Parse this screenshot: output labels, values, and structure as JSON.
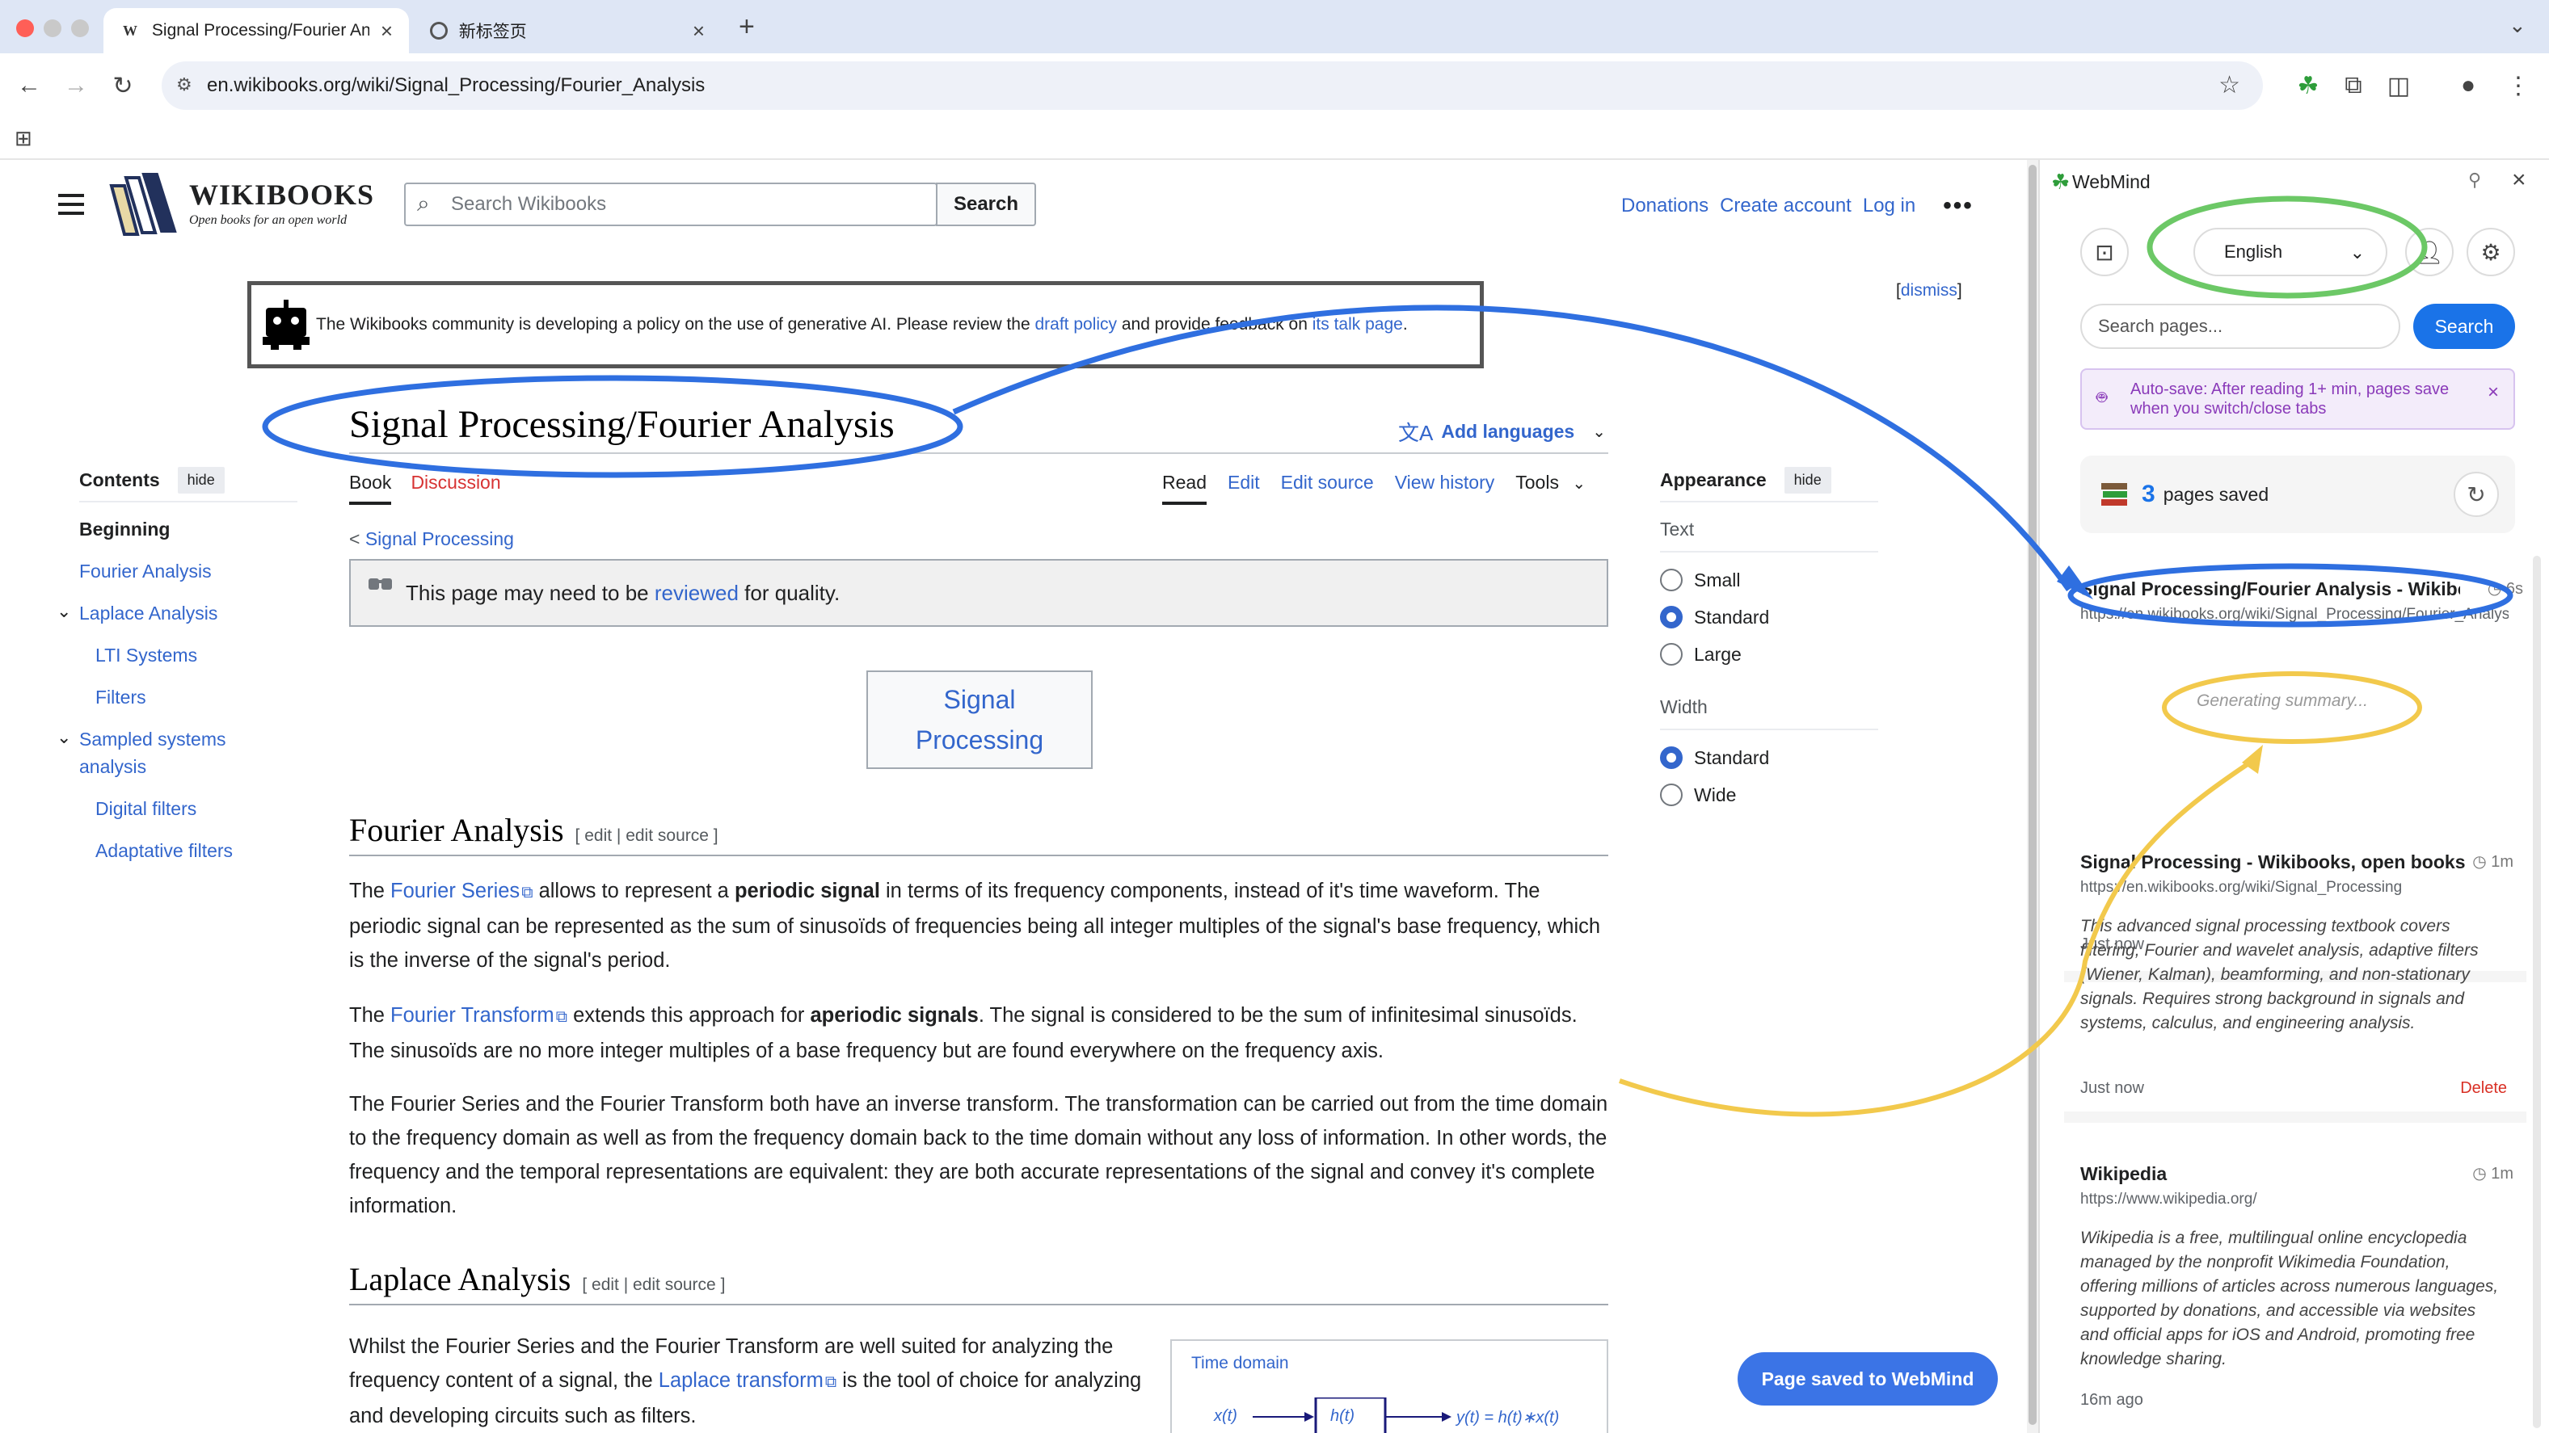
{
  "browser": {
    "tabs": [
      {
        "title": "Signal Processing/Fourier Analysis - Wikibooks, open books for an open world"
      },
      {
        "title": "新标签页"
      }
    ],
    "url": "en.wikibooks.org/wiki/Signal_Processing/Fourier_Analysis"
  },
  "wiki": {
    "logo_word": "WIKIBOOKS",
    "logo_tagline": "Open books for an open world",
    "search_placeholder": "Search Wikibooks",
    "search_button": "Search",
    "user_links": [
      "Donations",
      "Create account",
      "Log in"
    ],
    "banner": {
      "text_1": "The Wikibooks community is developing a policy on the use of generative AI. Please review the",
      "link_1": "draft policy",
      "text_2": "and provide feedback on",
      "link_2": "its talk page",
      "text_3": "."
    },
    "dismiss": "dismiss",
    "toc": {
      "title": "Contents",
      "hide": "hide",
      "items": [
        "Beginning",
        "Fourier Analysis",
        "Laplace Analysis",
        "LTI Systems",
        "Filters",
        "Sampled systems",
        "analysis",
        "Digital filters",
        "Adaptative filters"
      ]
    },
    "page_title": "Signal Processing/Fourier Analysis",
    "add_languages": "Add languages",
    "tabs_left": [
      "Book",
      "Discussion"
    ],
    "tabs_right": [
      "Read",
      "Edit",
      "Edit source",
      "View history",
      "Tools"
    ],
    "appearance": {
      "title": "Appearance",
      "hide": "hide",
      "text_label": "Text",
      "text_options": [
        "Small",
        "Standard",
        "Large"
      ],
      "text_selected": 1,
      "width_label": "Width",
      "width_options": [
        "Standard",
        "Wide"
      ],
      "width_selected": 0
    },
    "breadcrumb_prefix": "<",
    "breadcrumb_link": "Signal Processing",
    "review_text_1": "This page may need to be",
    "review_link": "reviewed",
    "review_text_2": "for quality.",
    "sigbox_line1": "Signal",
    "sigbox_line2": "Processing",
    "section1": {
      "heading": "Fourier Analysis",
      "edit": "[ edit | edit source ]",
      "p1_a": "The",
      "p1_link": "Fourier Series",
      "p1_b": "allows to represent a",
      "p1_bold": "periodic signal",
      "p1_c": "in terms of its frequency components, instead of it's time waveform. The periodic signal can be represented as the sum of sinusoïds of frequencies being all integer multiples of the signal's base frequency, which is the inverse of the signal's period.",
      "p2_a": "The",
      "p2_link": "Fourier Transform",
      "p2_b": "extends this approach for",
      "p2_bold": "aperiodic signals",
      "p2_c": ". The signal is considered to be the sum of infinitesimal sinusoïds. The sinusoïds are no more integer multiples of a base frequency but are found everywhere on the frequency axis.",
      "p3": "The Fourier Series and the Fourier Transform both have an inverse transform. The transformation can be carried out from the time domain to the frequency domain as well as from the frequency domain back to the time domain without any loss of information. In other words, the frequency and the temporal representations are equivalent: they are both accurate representations of the signal and convey it's complete information."
    },
    "section2": {
      "heading": "Laplace Analysis",
      "edit": "[ edit | edit source ]",
      "p1_a": "Whilst the Fourier Series and the Fourier Transform are well suited for analyzing the frequency content of a signal, the",
      "p1_link": "Laplace transform",
      "p1_b": "is the tool of choice for analyzing and developing circuits such as filters."
    },
    "diagram": {
      "label": "Time domain",
      "x": "x(t)",
      "h": "h(t)",
      "y": "y(t) = h(t)∗x(t)"
    },
    "toast": "Page saved to WebMind"
  },
  "webmind": {
    "title": "WebMind",
    "language": "English",
    "search_placeholder": "Search pages...",
    "search_button": "Search",
    "autosave_text": "Auto-save: After reading 1+ min, pages save when you switch/close tabs",
    "saved_count": "3",
    "saved_label": "pages saved",
    "cards": [
      {
        "title": "Signal Processing/Fourier Analysis - Wikibooks, open books for an open world",
        "time": "6s",
        "url": "https://en.wikibooks.org/wiki/Signal_Processing/Fourier_Analysis",
        "summary": "Generating summary...",
        "age": "Just now"
      },
      {
        "title": "Signal Processing - Wikibooks, open books for an open world",
        "time": "1m",
        "url": "https://en.wikibooks.org/wiki/Signal_Processing",
        "summary": "This advanced signal processing textbook covers filtering, Fourier and wavelet analysis, adaptive filters (Wiener, Kalman), beamforming, and non-stationary signals. Requires strong background in signals and systems, calculus, and engineering analysis.",
        "age": "Just now",
        "delete": "Delete"
      },
      {
        "title": "Wikipedia",
        "time": "1m",
        "url": "https://www.wikipedia.org/",
        "summary": "Wikipedia is a free, multilingual online encyclopedia managed by the nonprofit Wikimedia Foundation, offering millions of articles across numerous languages, supported by donations, and accessible via websites and official apps for iOS and Android, promoting free knowledge sharing.",
        "age": "16m ago"
      }
    ]
  },
  "colors": {
    "annotation_blue": "#2f6fe0",
    "annotation_green": "#6cc866",
    "annotation_yellow": "#f2c94c",
    "wiki_link": "#3366cc",
    "webmind_accent": "#1a73e8"
  }
}
